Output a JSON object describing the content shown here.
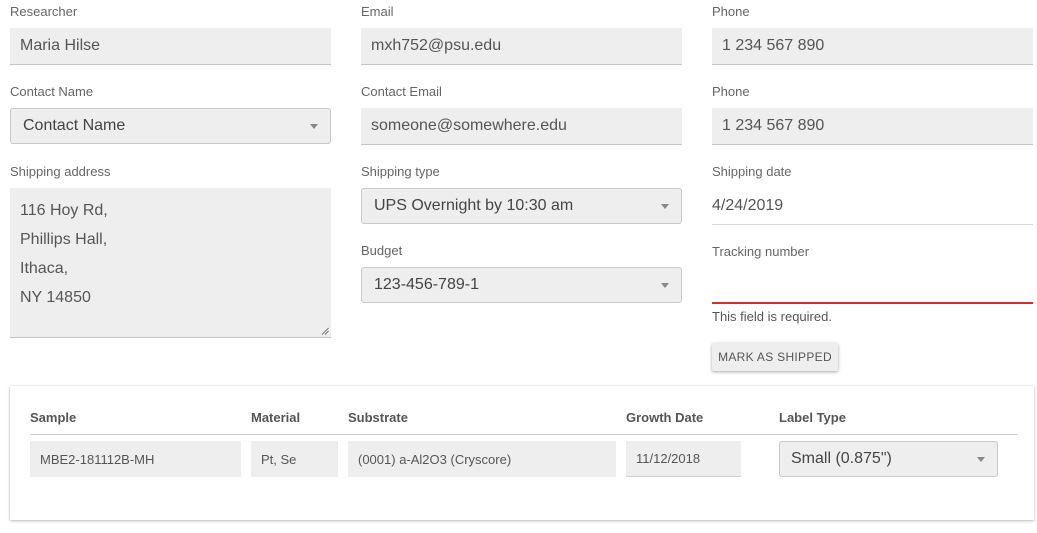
{
  "form": {
    "researcher_label": "Researcher",
    "researcher_value": "Maria Hilse",
    "email_label": "Email",
    "email_value": "mxh752@psu.edu",
    "phone_label": "Phone",
    "phone_value": "1 234 567 890",
    "contact_name_label": "Contact Name",
    "contact_name_value": "Contact Name",
    "contact_email_label": "Contact Email",
    "contact_email_value": "someone@somewhere.edu",
    "contact_phone_label": "Phone",
    "contact_phone_value": "1 234 567 890",
    "shipping_address_label": "Shipping address",
    "shipping_address_lines": [
      "116 Hoy Rd,",
      "Phillips Hall,",
      "Ithaca,",
      "NY 14850"
    ],
    "shipping_type_label": "Shipping type",
    "shipping_type_value": "UPS Overnight by 10:30 am",
    "shipping_date_label": "Shipping date",
    "shipping_date_value": "4/24/2019",
    "budget_label": "Budget",
    "budget_value": "123-456-789-1",
    "tracking_label": "Tracking number",
    "tracking_value": "",
    "tracking_error": "This field is required.",
    "error_color": "#d32f2f",
    "mark_shipped_label": "MARK AS SHIPPED"
  },
  "samples": {
    "headers": {
      "sample": "Sample",
      "material": "Material",
      "substrate": "Substrate",
      "growth_date": "Growth Date",
      "label_type": "Label Type"
    },
    "rows": [
      {
        "sample": "MBE2-181112B-MH",
        "material": "Pt, Se",
        "substrate": "(0001) a-Al2O3 (Cryscore)",
        "growth_date": "11/12/2018",
        "label_type": "Small (0.875\")"
      }
    ]
  },
  "icons": {
    "dropdown": "chevron-down-icon",
    "resize": "resize-grip-icon"
  }
}
